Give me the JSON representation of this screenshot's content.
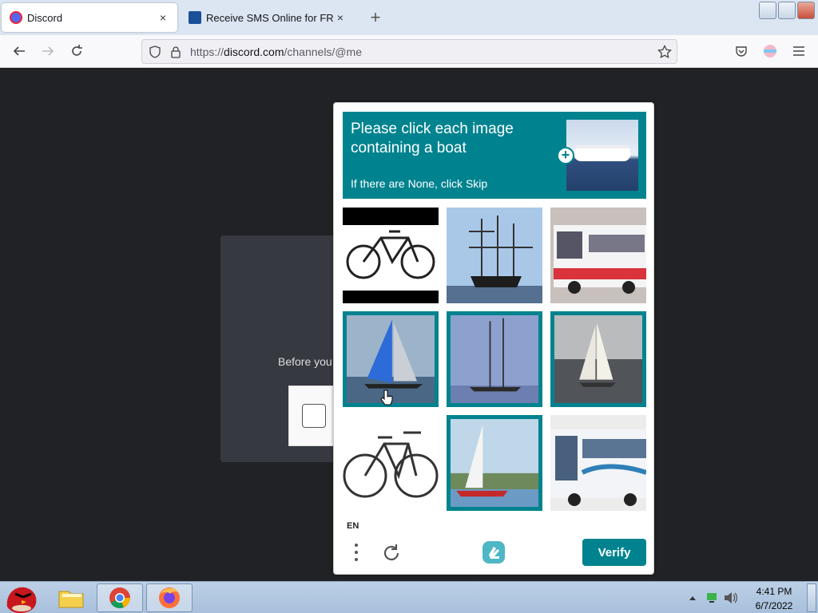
{
  "browser": {
    "tabs": [
      {
        "title": "Discord",
        "close": "×"
      },
      {
        "title": "Receive SMS Online for FREE",
        "close": "×"
      }
    ],
    "new_tab": "+",
    "url": {
      "scheme": "https://",
      "host": "discord.com",
      "path": "/channels/@me"
    },
    "icons": [
      "back-icon",
      "forward-icon",
      "reload-icon",
      "shield-icon",
      "lock-icon",
      "star-icon",
      "pocket-icon",
      "account-icon",
      "menu-icon"
    ]
  },
  "discord": {
    "prompt_text": "Before you"
  },
  "captcha": {
    "prompt": "Please click each image containing a boat",
    "subprompt": "If there are None, click Skip",
    "plus": "+",
    "language": "EN",
    "verify_label": "Verify",
    "accent": "#00838f",
    "tiles": [
      {
        "subject": "bicycle",
        "selected": false
      },
      {
        "subject": "sailing-ship",
        "selected": false
      },
      {
        "subject": "bus",
        "selected": false
      },
      {
        "subject": "sailboat",
        "selected": true
      },
      {
        "subject": "sailboat",
        "selected": true
      },
      {
        "subject": "sailboat",
        "selected": true
      },
      {
        "subject": "bicycle",
        "selected": false
      },
      {
        "subject": "sailboat",
        "selected": true
      },
      {
        "subject": "bus",
        "selected": false
      }
    ]
  },
  "taskbar": {
    "time": "4:41 PM",
    "date": "6/7/2022",
    "items": [
      "angry-birds-start-icon",
      "folder-icon",
      "chrome-icon",
      "firefox-icon"
    ]
  }
}
